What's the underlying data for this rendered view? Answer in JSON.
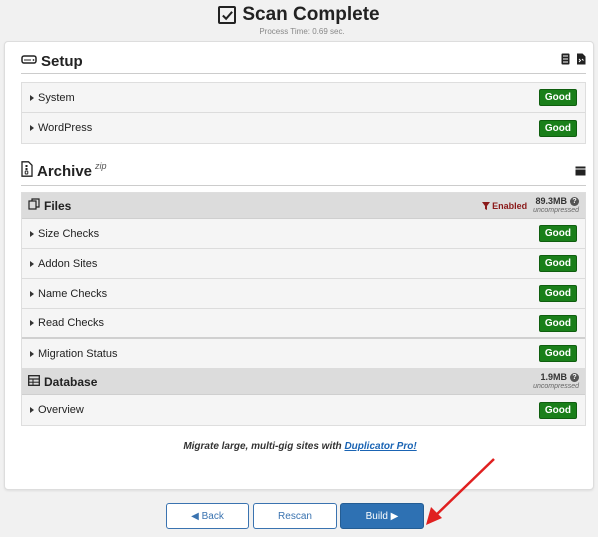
{
  "header": {
    "title": "Scan Complete",
    "process_time": "Process Time: 0.69 sec."
  },
  "setup": {
    "title": "Setup",
    "items": [
      {
        "label": "System",
        "status": "Good"
      },
      {
        "label": "WordPress",
        "status": "Good"
      }
    ]
  },
  "archive": {
    "title": "Archive",
    "sup": "zip",
    "files": {
      "title": "Files",
      "filter_label": "Enabled",
      "size": "89.3MB",
      "size_note": "uncompressed",
      "items": [
        {
          "label": "Size Checks",
          "status": "Good"
        },
        {
          "label": "Addon Sites",
          "status": "Good"
        },
        {
          "label": "Name Checks",
          "status": "Good"
        },
        {
          "label": "Read Checks",
          "status": "Good"
        }
      ]
    },
    "migration": {
      "label": "Migration Status",
      "status": "Good"
    },
    "database": {
      "title": "Database",
      "size": "1.9MB",
      "size_note": "uncompressed",
      "items": [
        {
          "label": "Overview",
          "status": "Good"
        }
      ]
    }
  },
  "promo": {
    "text": "Migrate large, multi-gig sites with",
    "link": "Duplicator Pro!"
  },
  "buttons": {
    "back": "◀ Back",
    "rescan": "Rescan",
    "build": "Build ▶"
  },
  "colors": {
    "good": "#1a7f1a",
    "primary": "#2e71b3",
    "annotation_arrow": "#e02020"
  }
}
